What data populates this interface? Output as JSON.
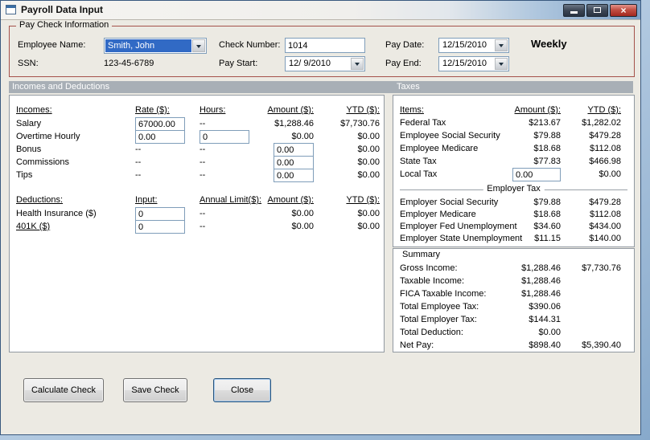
{
  "window": {
    "title": "Payroll Data Input",
    "close_glyph": "×"
  },
  "paycheck": {
    "legend": "Pay Check Information",
    "employee_name_label": "Employee Name:",
    "employee_name_value": "Smith, John",
    "ssn_label": "SSN:",
    "ssn_value": "123-45-6789",
    "check_number_label": "Check Number:",
    "check_number_value": "1014",
    "pay_start_label": "Pay Start:",
    "pay_start_value": "12/ 9/2010",
    "pay_date_label": "Pay Date:",
    "pay_date_value": "12/15/2010",
    "pay_end_label": "Pay End:",
    "pay_end_value": "12/15/2010",
    "frequency": "Weekly"
  },
  "section_headers": {
    "incomes": "Incomes and Deductions",
    "taxes": "Taxes"
  },
  "incomes": {
    "headers": {
      "name": "Incomes:",
      "rate": "Rate ($):",
      "hours": "Hours:",
      "amount": "Amount ($):",
      "ytd": "YTD ($):"
    },
    "rows": [
      {
        "label": "Salary",
        "rate": "67000.00",
        "hours": "--",
        "amount": "$1,288.46",
        "ytd": "$7,730.76"
      },
      {
        "label": "Overtime Hourly",
        "rate": "0.00",
        "hours": "0",
        "amount": "$0.00",
        "ytd": "$0.00"
      },
      {
        "label": "Bonus",
        "rate": "--",
        "hours": "--",
        "amount": "0.00",
        "ytd": "$0.00"
      },
      {
        "label": "Commissions",
        "rate": "--",
        "hours": "--",
        "amount": "0.00",
        "ytd": "$0.00"
      },
      {
        "label": "Tips",
        "rate": "--",
        "hours": "--",
        "amount": "0.00",
        "ytd": "$0.00"
      }
    ]
  },
  "deductions": {
    "headers": {
      "name": "Deductions:",
      "input": "Input:",
      "limit": "Annual Limit($):",
      "amount": "Amount ($):",
      "ytd": "YTD ($):"
    },
    "rows": [
      {
        "label": "Health Insurance  ($)",
        "input": "0",
        "limit": "--",
        "amount": "$0.00",
        "ytd": "$0.00"
      },
      {
        "label": "401K  ($)",
        "input": "0",
        "limit": "--",
        "amount": "$0.00",
        "ytd": "$0.00"
      }
    ]
  },
  "taxes": {
    "headers": {
      "items": "Items:",
      "amount": "Amount ($):",
      "ytd": "YTD ($):"
    },
    "employee_rows": [
      {
        "label": "Federal Tax",
        "amount": "$213.67",
        "ytd": "$1,282.02"
      },
      {
        "label": "Employee Social Security",
        "amount": "$79.88",
        "ytd": "$479.28"
      },
      {
        "label": "Employee Medicare",
        "amount": "$18.68",
        "ytd": "$112.08"
      },
      {
        "label": "State Tax",
        "amount": "$77.83",
        "ytd": "$466.98"
      },
      {
        "label": "Local Tax",
        "amount": "0.00",
        "ytd": "$0.00"
      }
    ],
    "employer_header": "Employer Tax",
    "employer_rows": [
      {
        "label": "Employer Social Security",
        "amount": "$79.88",
        "ytd": "$479.28"
      },
      {
        "label": "Employer Medicare",
        "amount": "$18.68",
        "ytd": "$112.08"
      },
      {
        "label": "Employer Fed Unemployment",
        "amount": "$34.60",
        "ytd": "$434.00"
      },
      {
        "label": "Employer State Unemployment",
        "amount": "$11.15",
        "ytd": "$140.00"
      }
    ]
  },
  "summary": {
    "legend": "Summary",
    "rows": [
      {
        "label": "Gross Income:",
        "amount": "$1,288.46",
        "ytd": "$7,730.76"
      },
      {
        "label": "Taxable Income:",
        "amount": "$1,288.46",
        "ytd": ""
      },
      {
        "label": "FICA Taxable Income:",
        "amount": "$1,288.46",
        "ytd": ""
      },
      {
        "label": "Total Employee Tax:",
        "amount": "$390.06",
        "ytd": ""
      },
      {
        "label": "Total Employer Tax:",
        "amount": "$144.31",
        "ytd": ""
      },
      {
        "label": "Total Deduction:",
        "amount": "$0.00",
        "ytd": ""
      },
      {
        "label": "Net Pay:",
        "amount": "$898.40",
        "ytd": "$5,390.40"
      }
    ]
  },
  "buttons": {
    "calculate": "Calculate Check",
    "save": "Save Check",
    "close": "Close"
  }
}
